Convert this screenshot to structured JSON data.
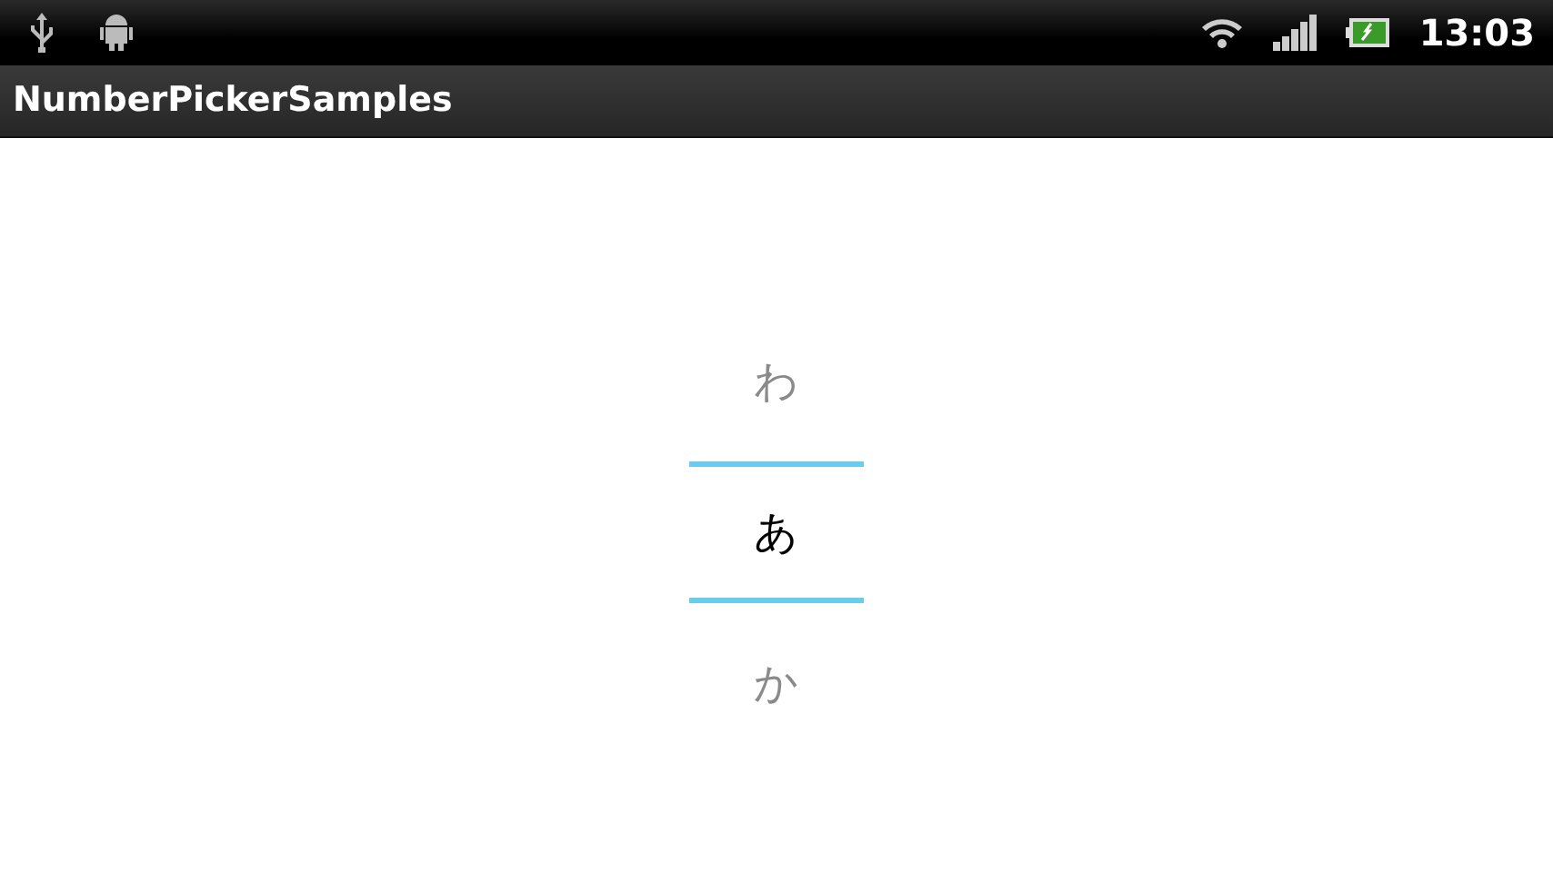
{
  "status_bar": {
    "time": "13:03"
  },
  "action_bar": {
    "title": "NumberPickerSamples"
  },
  "picker": {
    "items": [
      {
        "label": "わ",
        "selected": false
      },
      {
        "label": "あ",
        "selected": true
      },
      {
        "label": "か",
        "selected": false
      }
    ]
  }
}
